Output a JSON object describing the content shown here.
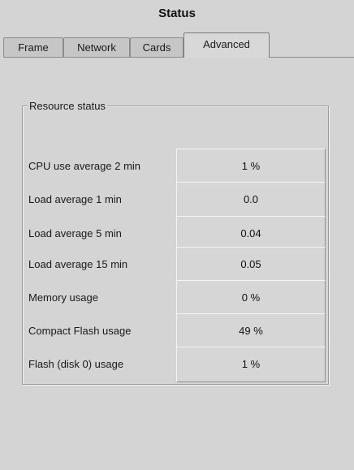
{
  "window": {
    "title": "Status"
  },
  "tabs": [
    {
      "label": "Frame",
      "active": false
    },
    {
      "label": "Network",
      "active": false
    },
    {
      "label": "Cards",
      "active": false
    },
    {
      "label": "Advanced",
      "active": true
    }
  ],
  "resource_status": {
    "legend": "Resource status",
    "rows": [
      {
        "label": "CPU use average 2 min",
        "value": "1 %"
      },
      {
        "label": "Load average 1 min",
        "value": "0.0"
      },
      {
        "label": "Load average 5 min",
        "value": "0.04"
      },
      {
        "label": "Load average 15 min",
        "value": "0.05"
      },
      {
        "label": "Memory usage",
        "value": "0 %"
      },
      {
        "label": "Compact Flash usage",
        "value": "49 %"
      },
      {
        "label": "Flash (disk 0) usage",
        "value": "1 %"
      }
    ]
  }
}
